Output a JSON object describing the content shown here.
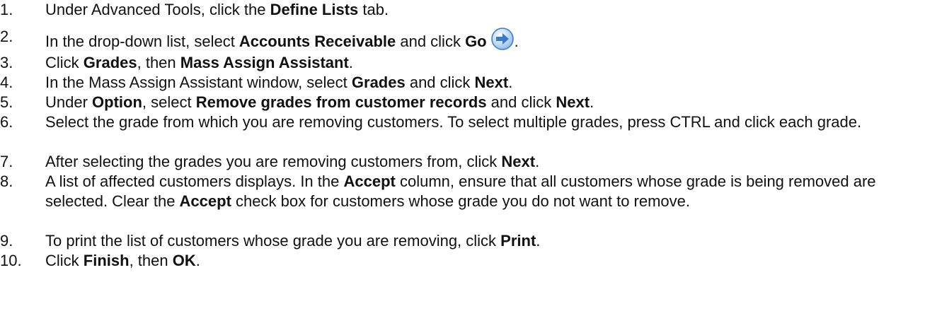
{
  "steps": [
    {
      "number": "1.",
      "segments": [
        {
          "t": "Under Advanced Tools, click the "
        },
        {
          "t": "Define Lists",
          "b": true
        },
        {
          "t": " tab."
        }
      ]
    },
    {
      "number": "2.",
      "segments": [
        {
          "t": "In the drop-down list, select "
        },
        {
          "t": "Accounts Receivable",
          "b": true
        },
        {
          "t": " and click "
        },
        {
          "t": "Go",
          "b": true
        },
        {
          "icon": "go-arrow-icon"
        },
        {
          "t": "."
        }
      ]
    },
    {
      "number": "3.",
      "segments": [
        {
          "t": "Click "
        },
        {
          "t": "Grades",
          "b": true
        },
        {
          "t": ", then "
        },
        {
          "t": "Mass Assign Assistant",
          "b": true
        },
        {
          "t": "."
        }
      ]
    },
    {
      "number": "4.",
      "segments": [
        {
          "t": "In the Mass Assign Assistant window, select "
        },
        {
          "t": "Grades",
          "b": true
        },
        {
          "t": " and click "
        },
        {
          "t": "Next",
          "b": true
        },
        {
          "t": "."
        }
      ]
    },
    {
      "number": "5.",
      "segments": [
        {
          "t": "Under "
        },
        {
          "t": "Option",
          "b": true
        },
        {
          "t": ", select "
        },
        {
          "t": "Remove grades from customer records",
          "b": true
        },
        {
          "t": " and click "
        },
        {
          "t": "Next",
          "b": true
        },
        {
          "t": "."
        }
      ]
    },
    {
      "number": "6.",
      "segments": [
        {
          "t": "Select the grade from which you are removing customers. To select multiple grades, press CTRL and click each grade."
        }
      ]
    },
    {
      "number": "7.",
      "segments": [
        {
          "t": "After selecting the grades you are removing customers from, click "
        },
        {
          "t": "Next",
          "b": true
        },
        {
          "t": "."
        }
      ]
    },
    {
      "number": "8.",
      "segments": [
        {
          "t": "A list of affected customers displays. In the "
        },
        {
          "t": "Accept",
          "b": true
        },
        {
          "t": " column, ensure that all customers whose grade is being removed are selected. Clear the "
        },
        {
          "t": "Accept",
          "b": true
        },
        {
          "t": " check box for customers whose grade you do not want to remove."
        }
      ]
    },
    {
      "number": "9.",
      "segments": [
        {
          "t": "To print the list of customers whose grade you are removing, click "
        },
        {
          "t": "Print",
          "b": true
        },
        {
          "t": "."
        }
      ]
    },
    {
      "number": "10.",
      "segments": [
        {
          "t": "Click "
        },
        {
          "t": "Finish",
          "b": true
        },
        {
          "t": ", then "
        },
        {
          "t": "OK",
          "b": true
        },
        {
          "t": "."
        }
      ]
    }
  ],
  "colors": {
    "text": "#111111",
    "icon_blue": "#3a78c9",
    "icon_light": "#bcd8f5"
  }
}
